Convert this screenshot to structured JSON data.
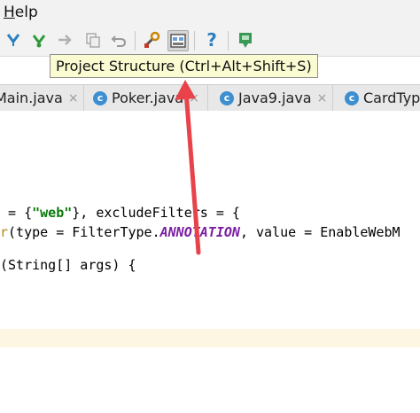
{
  "menubar": {
    "help_label": "Help",
    "help_mnemonic": "H",
    "help_rest": "elp"
  },
  "toolbar": {
    "icons": [
      "back-arrow-icon",
      "forward-arrow-icon",
      "navigate-icon",
      "copy-icon",
      "undo-icon",
      "settings-icon",
      "project-structure-icon",
      "help-icon",
      "sdk-download-icon"
    ]
  },
  "tooltip": {
    "text": "Project Structure (Ctrl+Alt+Shift+S)"
  },
  "tabs": [
    {
      "label": "Main.java",
      "icon": "",
      "close": "×"
    },
    {
      "label": "Poker.java",
      "icon": "c",
      "close": "×"
    },
    {
      "label": "Java9.java",
      "icon": "c",
      "close": "×"
    },
    {
      "label": "CardTyp",
      "icon": "c",
      "close": ""
    }
  ],
  "code": {
    "line1_pre": " = {",
    "line1_str": "\"web\"",
    "line1_post": "}, excludeFilters = {",
    "line2_mth": "r",
    "line2_pre": "(type = FilterType.",
    "line2_ann": "ANNOTATION",
    "line2_post": ", value = EnableWebM",
    "line3": "(String[] args) {"
  },
  "colors": {
    "arrow": "#e8434a",
    "tooltip_bg": "#fbfbd2",
    "class_icon": "#3d8fd1"
  }
}
